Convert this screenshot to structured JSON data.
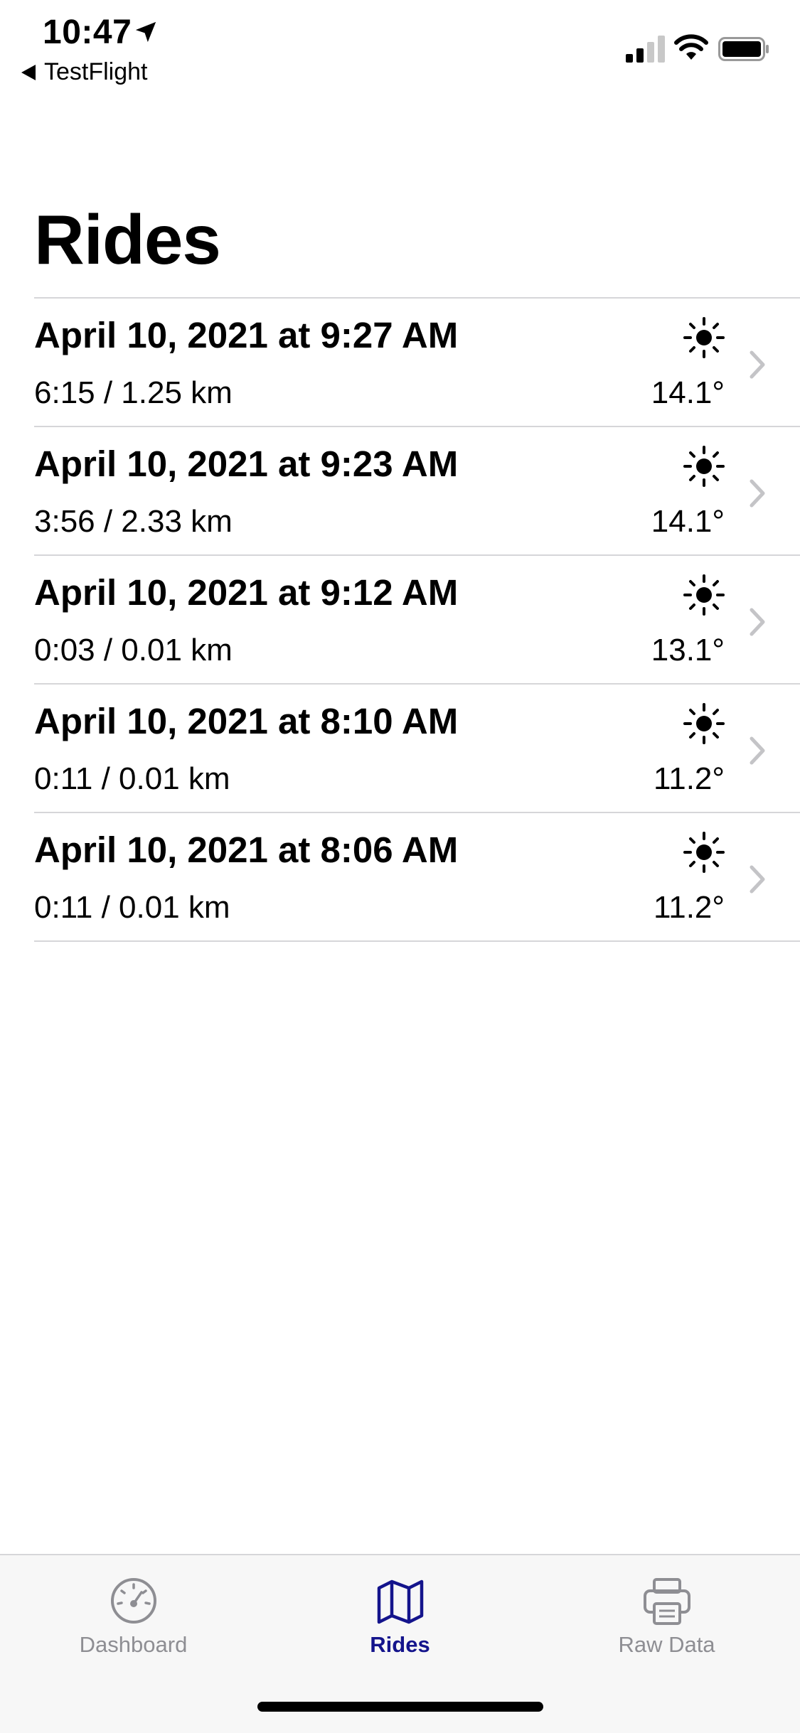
{
  "status_bar": {
    "time": "10:47",
    "back_label": "TestFlight"
  },
  "page": {
    "title": "Rides"
  },
  "rides": [
    {
      "title": "April 10, 2021 at 9:27 AM",
      "stats": "6:15 / 1.25 km",
      "temp": "14.1°",
      "weather_icon": "sun-icon"
    },
    {
      "title": "April 10, 2021 at 9:23 AM",
      "stats": "3:56 / 2.33 km",
      "temp": "14.1°",
      "weather_icon": "sun-icon"
    },
    {
      "title": "April 10, 2021 at 9:12 AM",
      "stats": "0:03 / 0.01 km",
      "temp": "13.1°",
      "weather_icon": "sun-icon"
    },
    {
      "title": "April 10, 2021 at 8:10 AM",
      "stats": "0:11 / 0.01 km",
      "temp": "11.2°",
      "weather_icon": "sun-icon"
    },
    {
      "title": "April 10, 2021 at 8:06 AM",
      "stats": "0:11 / 0.01 km",
      "temp": "11.2°",
      "weather_icon": "sun-icon"
    }
  ],
  "tab_bar": {
    "tabs": [
      {
        "label": "Dashboard",
        "icon": "speedometer-icon",
        "active": false
      },
      {
        "label": "Rides",
        "icon": "map-icon",
        "active": true
      },
      {
        "label": "Raw Data",
        "icon": "printer-icon",
        "active": false
      }
    ]
  },
  "colors": {
    "accent": "#14148c",
    "inactive_tab": "#8e8e93",
    "separator": "#d6d6d9",
    "chevron": "#c4c4c7"
  }
}
